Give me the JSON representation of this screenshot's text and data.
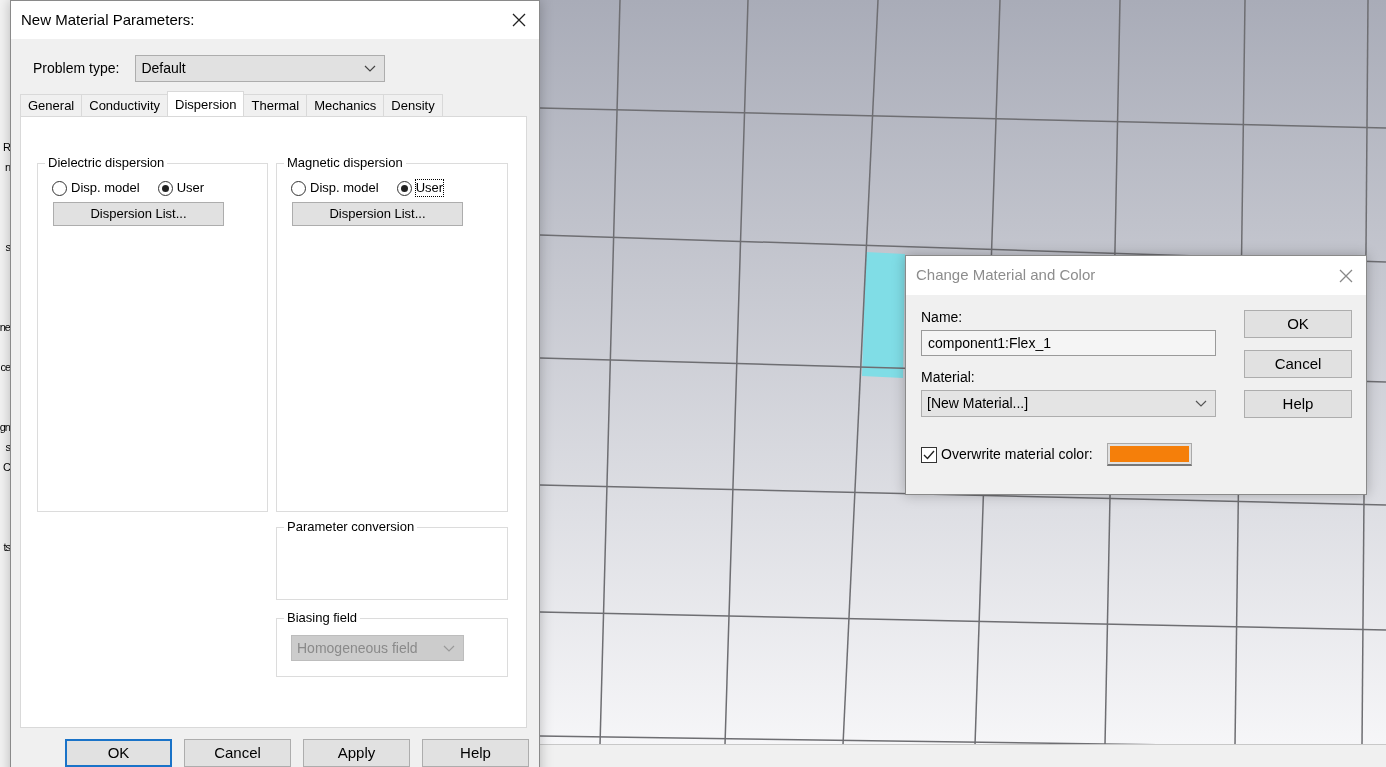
{
  "left_panel_fragments": [
    "R",
    "n",
    "s",
    "ne",
    "ce",
    "gn",
    "s",
    "C",
    "ts"
  ],
  "material_dialog": {
    "title": "New Material Parameters:",
    "problem_type": {
      "label": "Problem type:",
      "value": "Default"
    },
    "tabs": [
      {
        "label": "General",
        "selected": false
      },
      {
        "label": "Conductivity",
        "selected": false
      },
      {
        "label": "Dispersion",
        "selected": true
      },
      {
        "label": "Thermal",
        "selected": false
      },
      {
        "label": "Mechanics",
        "selected": false
      },
      {
        "label": "Density",
        "selected": false
      }
    ],
    "dielectric_dispersion": {
      "title": "Dielectric dispersion",
      "options": [
        {
          "label": "Disp. model",
          "selected": false,
          "focused": false
        },
        {
          "label": "User",
          "selected": true,
          "focused": false
        }
      ],
      "button": "Dispersion List..."
    },
    "magnetic_dispersion": {
      "title": "Magnetic dispersion",
      "options": [
        {
          "label": "Disp. model",
          "selected": false,
          "focused": false
        },
        {
          "label": "User",
          "selected": true,
          "focused": true
        }
      ],
      "button": "Dispersion List..."
    },
    "parameter_conversion": {
      "title": "Parameter conversion"
    },
    "biasing_field": {
      "title": "Biasing field",
      "value": "Homogeneous field",
      "disabled": true
    },
    "buttons": [
      {
        "label": "OK",
        "default": true
      },
      {
        "label": "Cancel",
        "default": false
      },
      {
        "label": "Apply",
        "default": false
      },
      {
        "label": "Help",
        "default": false
      }
    ]
  },
  "change_dialog": {
    "title": "Change Material and Color",
    "name": {
      "label": "Name:",
      "value": "component1:Flex_1"
    },
    "material": {
      "label": "Material:",
      "value": "[New Material...]"
    },
    "overwrite_color": {
      "label": "Overwrite material color:",
      "checked": true,
      "color": "#f57f0a"
    },
    "buttons": [
      "OK",
      "Cancel",
      "Help"
    ]
  }
}
